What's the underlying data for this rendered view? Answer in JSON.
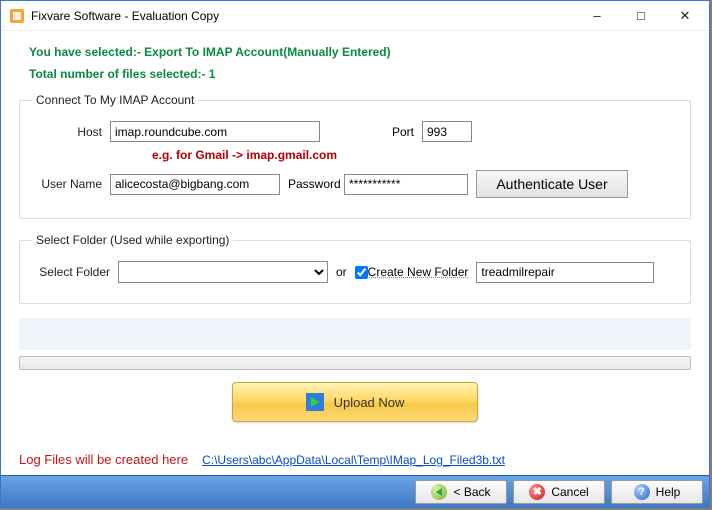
{
  "window": {
    "title": "Fixvare Software - Evaluation Copy"
  },
  "header": {
    "selection_msg": "You have selected:- Export To IMAP Account(Manually Entered)",
    "files_msg": "Total number of files selected:- 1"
  },
  "imap": {
    "legend": "Connect To My IMAP Account",
    "host_label": "Host",
    "host_value": "imap.roundcube.com",
    "port_label": "Port",
    "port_value": "993",
    "hint": "e.g. for Gmail -> imap.gmail.com",
    "user_label": "User Name",
    "user_value": "alicecosta@bigbang.com",
    "pass_label": "Password",
    "pass_value": "***********",
    "auth_btn": "Authenticate User"
  },
  "folder": {
    "legend": "Select Folder (Used while exporting)",
    "select_label": "Select Folder",
    "or": "or",
    "create_label": "Create New Folder",
    "create_checked": true,
    "new_folder_value": "treadmilrepair"
  },
  "upload_btn": "Upload Now",
  "log": {
    "label": "Log Files will be created here",
    "path": "C:\\Users\\abc\\AppData\\Local\\Temp\\IMap_Log_Filed3b.txt"
  },
  "footer": {
    "back": "< Back",
    "cancel": "Cancel",
    "help": "Help"
  }
}
